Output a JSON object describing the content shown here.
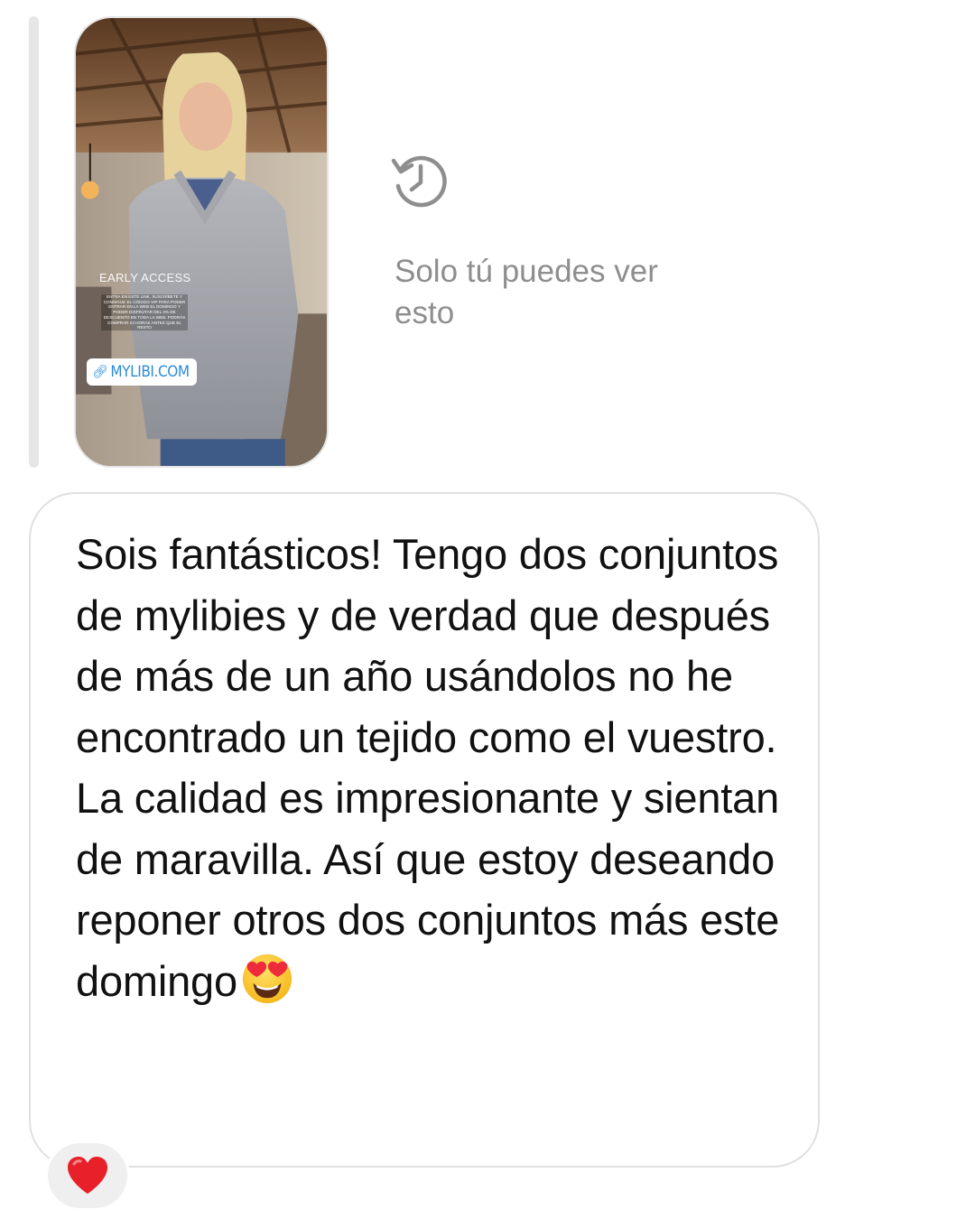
{
  "story_reply": {
    "story": {
      "title_text": "EARLY ACCESS",
      "small_text": "ENTRA EN ESTE LINK, SUSCRÍBETE Y CONSIGUE EL CÓDIGO VIP PARA PODER ENTRAR EN LA WEB EL DOMINGO Y PODER DISFRUTAR DEL 4% DE DESCUENTO EN TODA LA WEB. PODRÁS COMPRAR 24 HORAS ANTES QUE EL RESTO",
      "link_icon": "link-icon",
      "link_label": "MYLIBI.COM"
    },
    "private_notice": {
      "icon": "history-clock-icon",
      "text": "Solo tú puedes ver esto"
    }
  },
  "message": {
    "text": "Sois fantásticos! Tengo dos conjuntos de mylibies y de verdad que después de más de un año usándolos no he encontrado un tejido como el vuestro. La calidad es impresionante y sientan de maravilla. Así que estoy deseando reponer otros dos conjuntos más este domingo",
    "trailing_emoji": "heart-eyes-emoji",
    "reaction": "red-heart-emoji"
  },
  "colors": {
    "bubble_border": "#e0e0e0",
    "muted_text": "#8e8e8e",
    "message_text": "#111111",
    "link": "#2a8bd8",
    "reaction_bg": "#efefef",
    "heart": "#e8202a"
  }
}
